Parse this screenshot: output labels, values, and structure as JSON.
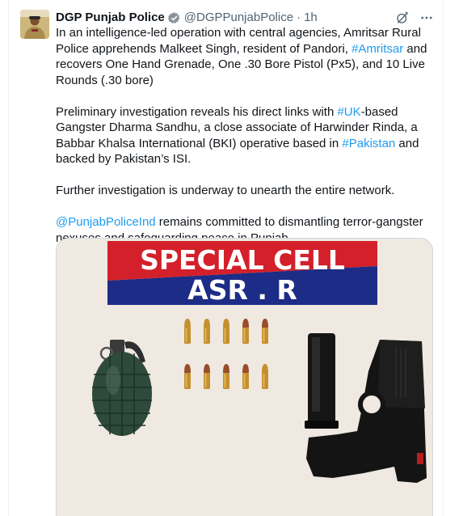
{
  "author": {
    "name": "DGP Punjab Police",
    "handle": "@DGPPunjabPolice",
    "separator": "·",
    "time": "1h",
    "verified_icon": "gold-verified-badge-icon"
  },
  "header_actions": [
    {
      "icon": "grok-icon"
    },
    {
      "icon": "more-icon"
    }
  ],
  "paragraphs": [
    [
      {
        "type": "text",
        "value": "In an intelligence-led operation with central agencies, Amritsar Rural Police apprehends Malkeet Singh, resident of Pandori, "
      },
      {
        "type": "link",
        "value": "#Amritsar"
      },
      {
        "type": "text",
        "value": " and recovers One Hand Grenade, One .30 Bore Pistol (Px5), and 10 Live Rounds (.30 bore)"
      }
    ],
    [
      {
        "type": "text",
        "value": "Preliminary investigation reveals his direct links with "
      },
      {
        "type": "link",
        "value": "#UK"
      },
      {
        "type": "text",
        "value": "-based Gangster Dharma Sandhu, a close associate of Harwinder Rinda, a Babbar Khalsa International (BKI) operative based in "
      },
      {
        "type": "link",
        "value": "#Pakistan"
      },
      {
        "type": "text",
        "value": " and backed by Pakistan’s ISI."
      }
    ],
    [
      {
        "type": "text",
        "value": "Further investigation is underway to unearth the entire network."
      }
    ],
    [
      {
        "type": "link",
        "value": "@PunjabPoliceInd"
      },
      {
        "type": "text",
        "value": " remains committed to dismantling terror-gangster nexuses and safeguarding peace in Punjab."
      }
    ]
  ],
  "media": {
    "banner_line1": "SPECIAL CELL",
    "banner_line2": "ASR . R",
    "colors": {
      "banner_red": "#d3202b",
      "banner_blue": "#1d2c86",
      "background": "#efe9e1",
      "grenade": "#2d4a3a",
      "pistol": "#141414",
      "rounds_brass": "#c58f2d",
      "rounds_copper": "#9a4d2a"
    },
    "rounds_top_row": [
      "brass",
      "brass",
      "brass",
      "copper",
      "copper"
    ],
    "rounds_bottom_row": [
      "copper",
      "copper",
      "copper",
      "copper",
      "brass"
    ]
  },
  "colors": {
    "text": "#0f1419",
    "secondary": "#536471",
    "link": "#1d9bf0",
    "border": "#cfd9de"
  }
}
